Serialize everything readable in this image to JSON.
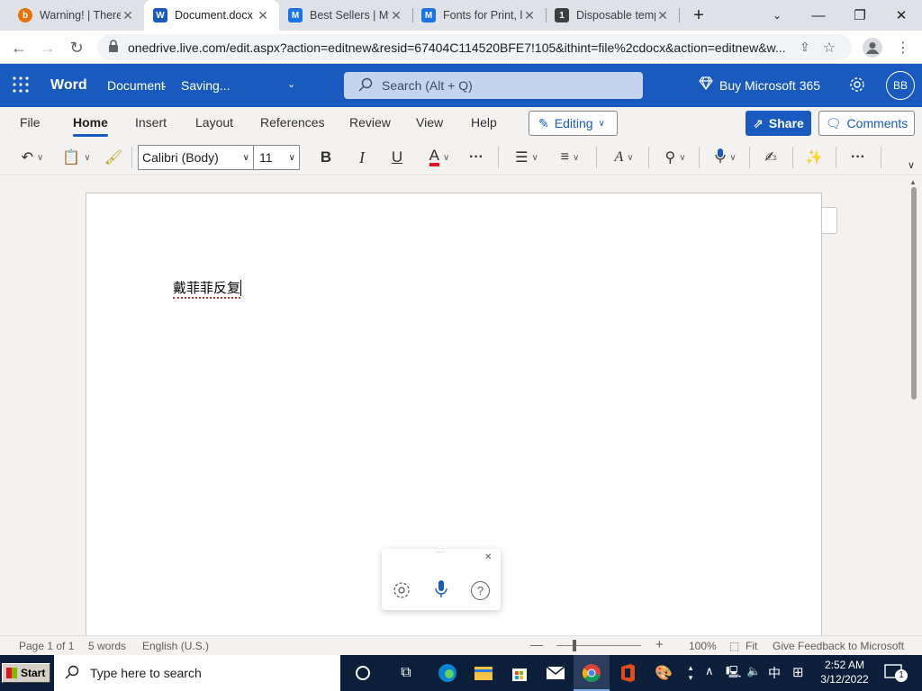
{
  "browser": {
    "tabs": [
      {
        "title": "Warning! | There",
        "favicon_color": "#e8710a",
        "favicon_glyph": "b"
      },
      {
        "title": "Document.docx",
        "favicon_color": "#185abd",
        "favicon_glyph": "W"
      },
      {
        "title": "Best Sellers | My",
        "favicon_color": "#1a73e8",
        "favicon_glyph": "M"
      },
      {
        "title": "Fonts for Print, l",
        "favicon_color": "#1a73e8",
        "favicon_glyph": "M"
      },
      {
        "title": "Disposable temp",
        "favicon_color": "#3c4043",
        "favicon_glyph": "1"
      }
    ],
    "new_tab": "+",
    "url": "onedrive.live.com/edit.aspx?action=editnew&resid=67404C114520BFE7!105&ithint=file%2cdocx&action=editnew&w...",
    "profile_initials": ""
  },
  "word": {
    "app_name": "Word",
    "doc_title": "Document",
    "doc_status": "Saving...",
    "search_placeholder": "Search (Alt + Q)",
    "buy_label": "Buy Microsoft 365",
    "user_initials": "BB",
    "brand_color": "#185abd"
  },
  "ribbon": {
    "tabs": [
      "File",
      "Home",
      "Insert",
      "Layout",
      "References",
      "Review",
      "View",
      "Help"
    ],
    "active_tab": "Home",
    "editing_label": "Editing",
    "share_label": "Share",
    "comments_label": "Comments",
    "font_name": "Calibri (Body)",
    "font_size": "11",
    "bold": "B",
    "italic": "I",
    "underline": "U",
    "font_color_letter": "A",
    "more": "···"
  },
  "document": {
    "text": "戴菲菲反复"
  },
  "statusbar": {
    "page": "Page 1 of 1",
    "words": "5 words",
    "language": "English (U.S.)",
    "zoom": "100%",
    "fit": "Fit",
    "feedback": "Give Feedback to Microsoft"
  },
  "taskbar": {
    "start_label": "Start",
    "search_placeholder": "Type here to search",
    "ime": "中",
    "time": "2:52 AM",
    "date": "3/12/2022",
    "notification_count": "1"
  }
}
